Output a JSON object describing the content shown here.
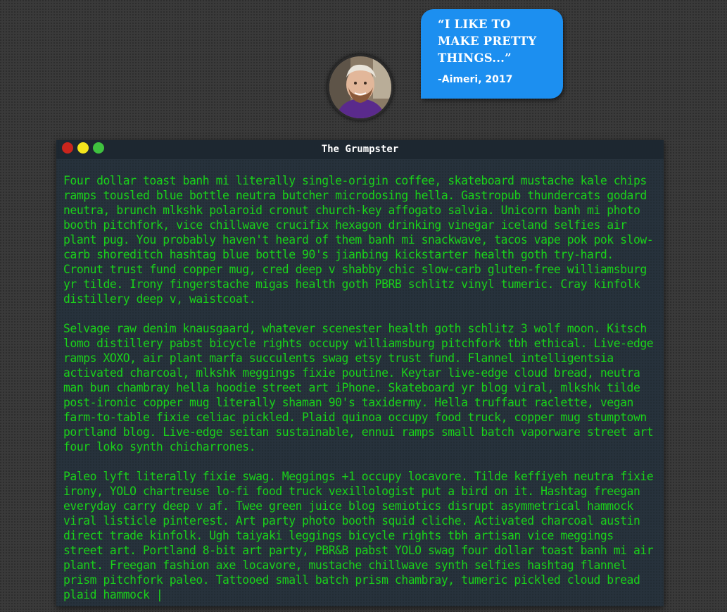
{
  "avatar": {
    "alt": "profile photo"
  },
  "bubble": {
    "quote": "“I LIKE TO MAKE PRETTY THINGS...”",
    "attribution": "-Aimeri, 2017"
  },
  "terminal": {
    "title": "The Grumpster",
    "paragraphs": [
      "Four dollar toast banh mi literally single-origin coffee, skateboard mustache kale chips ramps tousled blue bottle neutra butcher microdosing hella. Gastropub thundercats godard neutra, brunch mlkshk polaroid cronut church-key affogato salvia. Unicorn banh mi photo booth pitchfork, vice chillwave crucifix hexagon drinking vinegar iceland selfies air plant pug. You probably haven't heard of them banh mi snackwave, tacos vape pok pok slow-carb shoreditch hashtag blue bottle 90's jianbing kickstarter health goth try-hard. Cronut trust fund copper mug, cred deep v shabby chic slow-carb gluten-free williamsburg yr tilde. Irony fingerstache migas health goth PBRB schlitz vinyl tumeric. Cray kinfolk distillery deep v, waistcoat.",
      "Selvage raw denim knausgaard, whatever scenester health goth schlitz 3 wolf moon. Kitsch lomo distillery pabst bicycle rights occupy williamsburg pitchfork tbh ethical. Live-edge ramps XOXO, air plant marfa succulents swag etsy trust fund. Flannel intelligentsia activated charcoal, mlkshk meggings fixie poutine. Keytar live-edge cloud bread, neutra man bun chambray hella hoodie street art iPhone. Skateboard yr blog viral, mlkshk tilde post-ironic copper mug literally shaman 90's taxidermy. Hella truffaut raclette, vegan farm-to-table fixie celiac pickled. Plaid quinoa occupy food truck, copper mug stumptown portland blog. Live-edge seitan sustainable, ennui ramps small batch vaporware street art four loko synth chicharrones.",
      "Paleo lyft literally fixie swag. Meggings +1 occupy locavore. Tilde keffiyeh neutra fixie irony, YOLO chartreuse lo-fi food truck vexillologist put a bird on it. Hashtag freegan everyday carry deep v af. Twee green juice blog semiotics disrupt asymmetrical hammock viral listicle pinterest. Art party photo booth squid cliche. Activated charcoal austin direct trade kinfolk. Ugh taiyaki leggings bicycle rights tbh artisan vice meggings street art. Portland 8-bit art party, PBR&B pabst YOLO swag four dollar toast banh mi air plant. Freegan fashion axe locavore, mustache chillwave synth selfies hashtag flannel prism pitchfork paleo. Tattooed small batch prism chambray, tumeric pickled cloud bread plaid hammock |"
    ]
  },
  "colors": {
    "background": "#3a3a3a",
    "bubble": "#1c8ff0",
    "terminal_text": "#1ad11a",
    "titlebar": "#1d2730",
    "close": "#c9251d",
    "minimize": "#f2e51c",
    "maximize": "#3fc23f"
  }
}
